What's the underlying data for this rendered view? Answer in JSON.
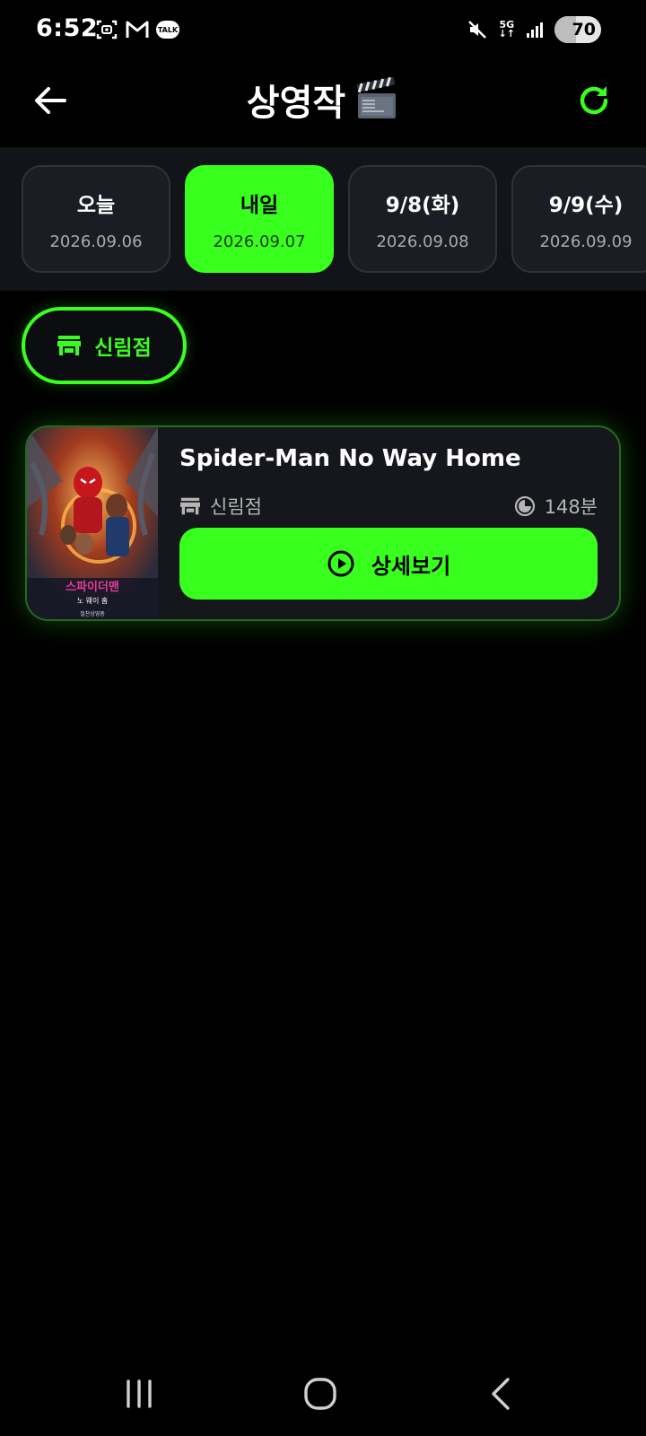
{
  "status_bar": {
    "time": "6:52",
    "talk_badge": "TALK",
    "network": "5G",
    "battery": "70"
  },
  "header": {
    "title": "상영작",
    "back_icon": "arrow-left-icon",
    "refresh_icon": "refresh-icon",
    "accent_color": "#39ff1e"
  },
  "dates": [
    {
      "label": "오늘",
      "date": "2026.09.06",
      "selected": false
    },
    {
      "label": "내일",
      "date": "2026.09.07",
      "selected": true
    },
    {
      "label": "9/8(화)",
      "date": "2026.09.08",
      "selected": false
    },
    {
      "label": "9/9(수)",
      "date": "2026.09.09",
      "selected": false
    }
  ],
  "branch": {
    "name": "신림점",
    "icon": "store-icon"
  },
  "movies": [
    {
      "title": "Spider-Man No Way Home",
      "branch": "신림점",
      "runtime": "148분",
      "detail_label": "상세보기",
      "poster_title": "스파이더맨",
      "poster_subtitle": "노 웨이 홈",
      "poster_footer": "절찬상영중"
    }
  ]
}
